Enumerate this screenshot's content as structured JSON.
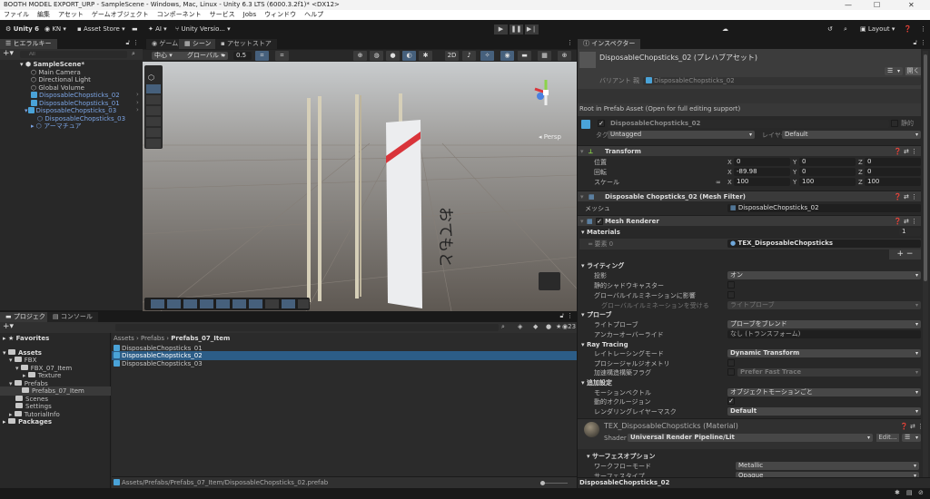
{
  "window": {
    "title": "BOOTH MODEL EXPORT_URP - SampleScene - Windows, Mac, Linux - Unity 6.3 LTS (6000.3.2f1)* <DX12>",
    "minimize": "—",
    "maximize": "☐",
    "close": "✕"
  },
  "menu": [
    "ファイル",
    "編集",
    "アセット",
    "ゲームオブジェクト",
    "コンポーネント",
    "サービス",
    "Jobs",
    "ウィンドウ",
    "ヘルプ"
  ],
  "toolbar": {
    "unity": "Unity 6",
    "account": "KN ▾",
    "asset_store": "Asset Store ▾",
    "ai": "AI ▾",
    "version_control": "Unity Versio... ▾",
    "layout": "Layout ▾",
    "play": "▶",
    "pause": "❚❚",
    "step": "▶❘"
  },
  "hierarchy": {
    "tab": "ヒエラルキー",
    "search_placeholder": "All",
    "items": [
      {
        "label": "SampleScene*"
      },
      {
        "label": "Main Camera"
      },
      {
        "label": "Directional Light"
      },
      {
        "label": "Global Volume"
      },
      {
        "label": "DisposableChopsticks_02"
      },
      {
        "label": "DisposableChopsticks_01"
      },
      {
        "label": "DisposableChopsticks_03"
      },
      {
        "label": "DisposableChopsticks_03"
      },
      {
        "label": "アーマチュア"
      }
    ]
  },
  "scene": {
    "tabs": [
      "ゲーム",
      "シーン",
      "アセットストア"
    ],
    "pivot": "中心 ▾",
    "space": "グローバル ▾",
    "snap": "0.5",
    "persp": "◂ Persp",
    "sleeve_text": "おてもと",
    "accent": "#d9343a"
  },
  "inspector": {
    "tab": "インスペクター",
    "asset_title": "DisposableChopsticks_02 (プレハブアセット)",
    "open_button": "開く",
    "variant_label": "バリアント 親",
    "variant_value": "DisposableChopsticks_02",
    "root_notice": "Root in Prefab Asset (Open for full editing support)",
    "object_name": "DisposableChopsticks_02",
    "static_label": "静的",
    "tag_label": "タグ",
    "tag_value": "Untagged",
    "layer_label": "レイヤー",
    "layer_value": "Default",
    "transform": {
      "title": "Transform",
      "rows": [
        {
          "label": "位置",
          "x": "0",
          "y": "0",
          "z": "0"
        },
        {
          "label": "回転",
          "x": "-89.98",
          "y": "0",
          "z": "0"
        },
        {
          "label": "スケール",
          "x": "100",
          "y": "100",
          "z": "100"
        }
      ]
    },
    "mesh_filter": {
      "title": "Disposable Chopsticks_02 (Mesh Filter)",
      "mesh_label": "メッシュ",
      "mesh_value": "DisposableChopsticks_02"
    },
    "mesh_renderer": {
      "title": "Mesh Renderer",
      "materials_label": "Materials",
      "materials_count": "1",
      "element_label": "要素 0",
      "element_value": "TEX_DisposableChopsticks"
    },
    "lighting": {
      "title": "ライティング",
      "cast_shadows_label": "投影",
      "cast_shadows": "オン",
      "static_shadow_label": "静的シャドウキャスター",
      "contribute_gi_label": "グローバルイルミネーションに影響",
      "receive_gi_label": "グローバルイルミネーションを受ける",
      "receive_gi": "ライトプローブ"
    },
    "probes": {
      "title": "プローブ",
      "light_probe_label": "ライトプローブ",
      "light_probe": "プローブをブレンド",
      "anchor_label": "アンカーオーバーライド",
      "anchor": "なし (トランスフォーム)"
    },
    "ray_tracing": {
      "title": "Ray Tracing",
      "mode_label": "レイトレーシングモード",
      "mode": "Dynamic Transform",
      "procedural_label": "プロシージャルジオメトリ",
      "accel_label": "加速構造構築フラグ",
      "accel": "Prefer Fast Trace"
    },
    "additional": {
      "title": "追加設定",
      "motion_label": "モーションベクトル",
      "motion": "オブジェクトモーションごと",
      "occlusion_label": "動的オクルージョン",
      "render_layer_label": "レンダリングレイヤーマスク",
      "render_layer": "Default"
    },
    "material": {
      "title": "TEX_DisposableChopsticks (Material)",
      "shader_label": "Shader",
      "shader": "Universal Render Pipeline/Lit",
      "edit": "Edit..."
    },
    "surface": {
      "title": "サーフェスオプション",
      "workflow_label": "ワークフローモード",
      "workflow": "Metallic",
      "surface_type_label": "サーフェスタイプ",
      "surface_type": "Opaque"
    },
    "footer": "DisposableChopsticks_02"
  },
  "project": {
    "tabs": [
      "プロジェクト",
      "コンソール"
    ],
    "count": "23",
    "tree": [
      {
        "label": "Favorites"
      },
      {
        "label": "Assets"
      },
      {
        "label": "FBX"
      },
      {
        "label": "FBX_07_Item"
      },
      {
        "label": "Texture"
      },
      {
        "label": "Prefabs"
      },
      {
        "label": "Prefabs_07_Item"
      },
      {
        "label": "Scenes"
      },
      {
        "label": "Settings"
      },
      {
        "label": "TutorialInfo"
      },
      {
        "label": "Packages"
      }
    ],
    "breadcrumb": [
      "Assets",
      "Prefabs",
      "Prefabs_07_Item"
    ],
    "files": [
      "DisposableChopsticks_01",
      "DisposableChopsticks_02",
      "DisposableChopsticks_03"
    ],
    "path": "Assets/Prefabs/Prefabs_07_Item/DisposableChopsticks_02.prefab"
  }
}
